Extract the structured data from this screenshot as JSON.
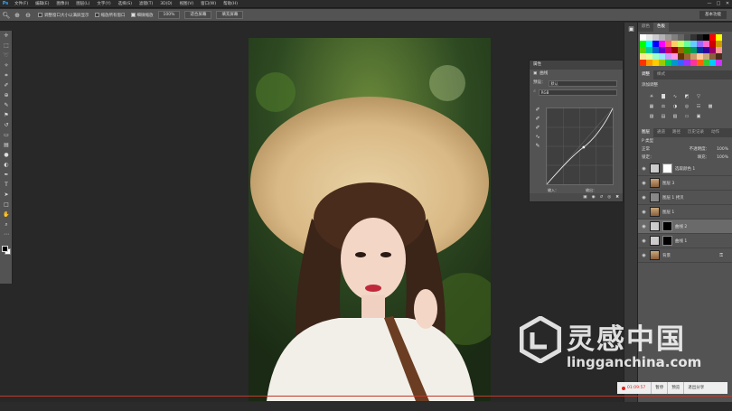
{
  "app": {
    "logo": "Ps"
  },
  "menu": [
    "文件(F)",
    "编辑(E)",
    "图像(I)",
    "图层(L)",
    "文字(Y)",
    "选择(S)",
    "滤镜(T)",
    "3D(D)",
    "视图(V)",
    "窗口(W)",
    "帮助(H)"
  ],
  "window_controls": [
    "—",
    "□",
    "✕"
  ],
  "options_bar": {
    "tool_icon": "zoom-icon",
    "check_resize": "调整窗口大小以满屏显示",
    "check_all_windows": "缩放所有窗口",
    "check_scrubby": "细微缩放",
    "zoom_value": "100%",
    "fit_screen": "适合屏幕",
    "fill_screen": "填充屏幕",
    "workspace": "基本功能"
  },
  "properties": {
    "title": "属性",
    "subtitle": "曲线",
    "preset_label": "预设：",
    "preset_value": "默认",
    "channel_value": "RGB",
    "input_label": "输入：",
    "output_label": "输出："
  },
  "swatches_panel": {
    "tabs": [
      "颜色",
      "色板"
    ],
    "active": 1
  },
  "adjustments_panel": {
    "tabs": [
      "调整",
      "样式"
    ],
    "hint": "添加调整"
  },
  "layers_panel": {
    "tabs": [
      "图层",
      "通道",
      "路径",
      "历史记录",
      "动作"
    ],
    "filter_label": "P 类型",
    "blend_mode": "正常",
    "opacity_label": "不透明度：",
    "opacity": "100%",
    "lock_label": "锁定：",
    "fill_label": "填充：",
    "fill": "100%",
    "layers": [
      {
        "name": "选取颜色 1",
        "thumb": "adjust",
        "mask": "white",
        "selected": false
      },
      {
        "name": "图层 3",
        "thumb": "photo",
        "mask": "",
        "selected": false
      },
      {
        "name": "图层 1 拷贝",
        "thumb": "gray",
        "mask": "",
        "selected": false
      },
      {
        "name": "图层 1",
        "thumb": "photo",
        "mask": "",
        "selected": false
      },
      {
        "name": "曲线 2",
        "thumb": "adjust",
        "mask": "dark",
        "selected": true
      },
      {
        "name": "曲线 1",
        "thumb": "adjust",
        "mask": "dark",
        "selected": false
      },
      {
        "name": "背景",
        "thumb": "photo",
        "mask": "",
        "selected": false,
        "locked": true
      }
    ]
  },
  "watermark": {
    "title": "灵感中国",
    "url": "lingganchina.com"
  },
  "recorder": {
    "time": "01:09:57",
    "buttons": [
      "暂停",
      "预览",
      "退出分享"
    ]
  },
  "colors": {
    "accent": "#31a8ff",
    "panel": "#535353",
    "canvas_bg": "#282828"
  }
}
